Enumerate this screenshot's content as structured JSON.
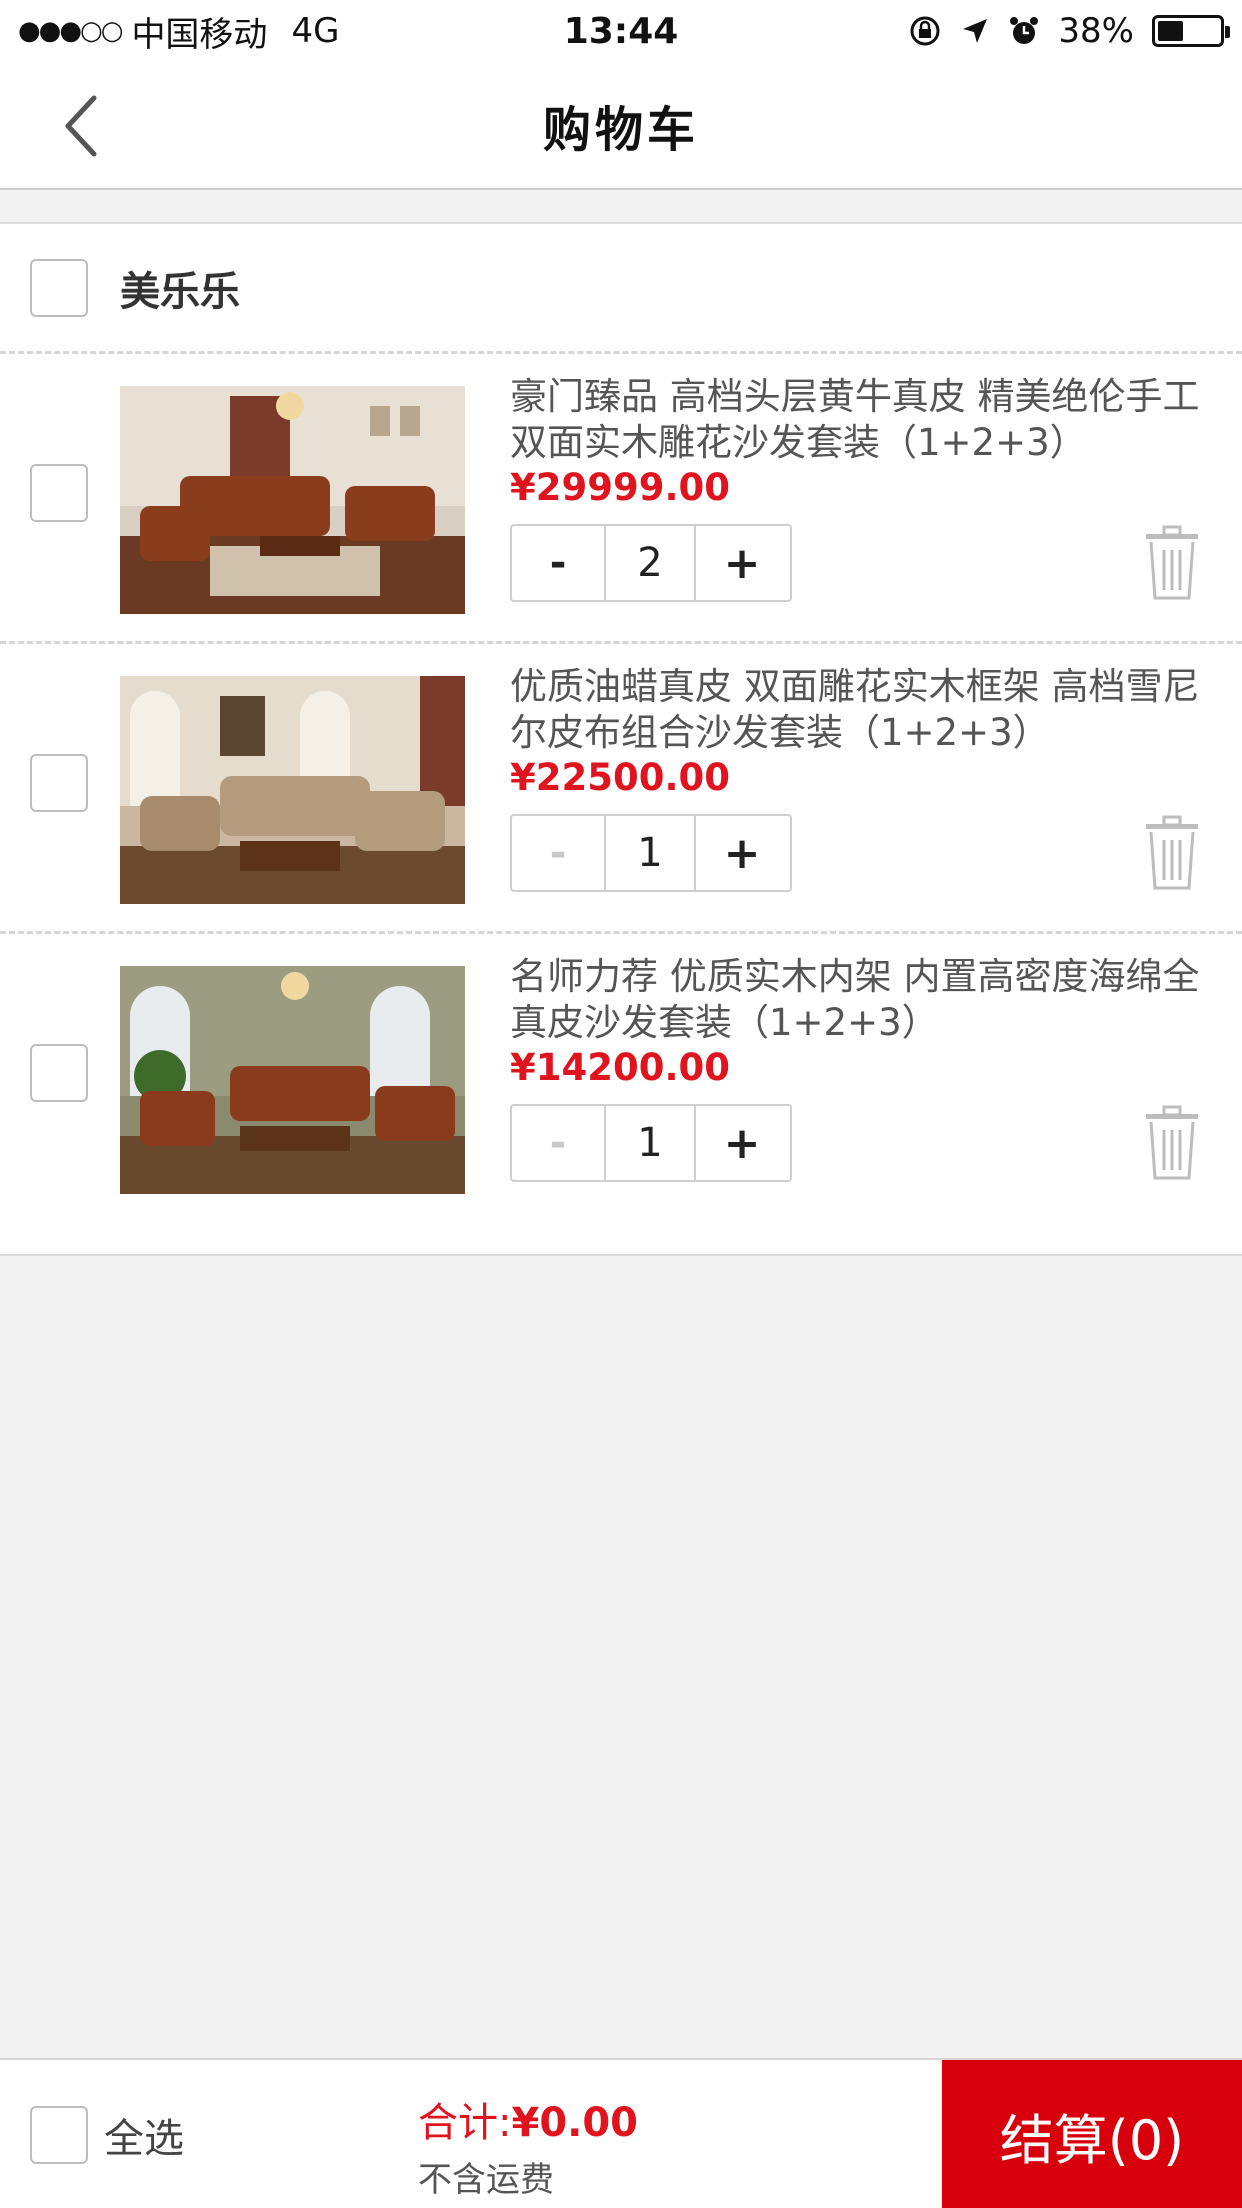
{
  "status_bar": {
    "signal": "●●●○○",
    "carrier": "中国移动",
    "network": "4G",
    "time": "13:44",
    "battery": "38%",
    "battery_level": 0.38
  },
  "nav": {
    "title": "购物车",
    "back_icon": "chevron-left-icon"
  },
  "store": {
    "name": "美乐乐"
  },
  "items": [
    {
      "title": "豪门臻品 高档头层黄牛真皮 精美绝伦手工双面实木雕花沙发套装（1+2+3）",
      "price": "¥29999.00",
      "quantity": "2",
      "minus": "-",
      "plus": "+"
    },
    {
      "title": "优质油蜡真皮 双面雕花实木框架 高档雪尼尔皮布组合沙发套装（1+2+3）",
      "price": "¥22500.00",
      "quantity": "1",
      "minus": "-",
      "plus": "+"
    },
    {
      "title": "名师力荐 优质实木内架 内置高密度海绵全真皮沙发套装（1+2+3）",
      "price": "¥14200.00",
      "quantity": "1",
      "minus": "-",
      "plus": "+"
    }
  ],
  "footer": {
    "select_all": "全选",
    "total_label": "合计:",
    "total_amount": "¥0.00",
    "shipping_note": "不含运费",
    "checkout": "结算(0)"
  },
  "colors": {
    "accent_red": "#e0141e",
    "checkout_bg": "#d9000d"
  }
}
